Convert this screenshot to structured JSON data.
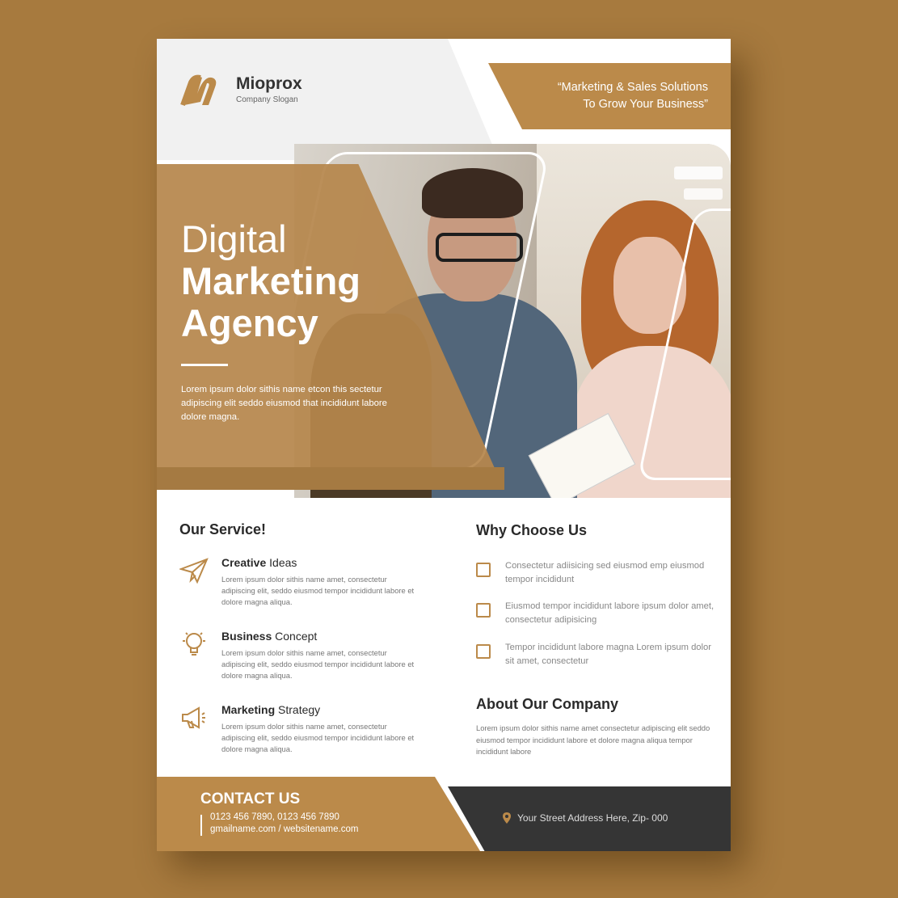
{
  "brand": {
    "name": "Mioprox",
    "slogan": "Company Slogan"
  },
  "tagline": {
    "line1": "“Marketing & Sales Solutions",
    "line2": "To Grow Your Business”"
  },
  "hero": {
    "title_line1": "Digital",
    "title_line2": "Marketing",
    "title_line3": "Agency",
    "description": "Lorem ipsum dolor sithis name etcon this sectetur adipiscing elit seddo eiusmod that incididunt labore dolore magna."
  },
  "services": {
    "heading": "Our Service!",
    "items": [
      {
        "name_bold": "Creative",
        "name_rest": " Ideas",
        "icon": "paper-plane-icon",
        "desc": "Lorem ipsum dolor sithis name amet, consectetur adipiscing elit, seddo eiusmod tempor incididunt labore et dolore magna aliqua."
      },
      {
        "name_bold": "Business",
        "name_rest": " Concept",
        "icon": "lightbulb-icon",
        "desc": "Lorem ipsum dolor sithis name amet, consectetur adipiscing elit, seddo eiusmod tempor incididunt labore et dolore magna aliqua."
      },
      {
        "name_bold": "Marketing",
        "name_rest": " Strategy",
        "icon": "megaphone-icon",
        "desc": "Lorem ipsum dolor sithis name amet, consectetur adipiscing elit, seddo eiusmod tempor incididunt labore et dolore magna aliqua."
      }
    ]
  },
  "why": {
    "heading": "Why Choose Us",
    "items": [
      "Consectetur adiisicing sed eiusmod emp eiusmod tempor incididunt",
      "Eiusmod tempor incididunt labore ipsum dolor amet, consectetur adipisicing",
      "Tempor incididunt labore magna Lorem ipsum dolor sit amet, consectetur"
    ]
  },
  "about": {
    "heading": "About Our Company",
    "text": "Lorem ipsum dolor sithis name amet consectetur adipiscing elit seddo eiusmod tempor incididunt labore et dolore magna aliqua tempor incididunt labore"
  },
  "contact": {
    "heading": "CONTACT US",
    "phones": "0123 456 7890, 0123 456 7890",
    "web": "gmailname.com / websitename.com",
    "address": "Your Street Address Here, Zip- 000"
  },
  "colors": {
    "accent": "#bb8a4a",
    "background": "#a77a3e",
    "footer_dark": "#353535"
  }
}
